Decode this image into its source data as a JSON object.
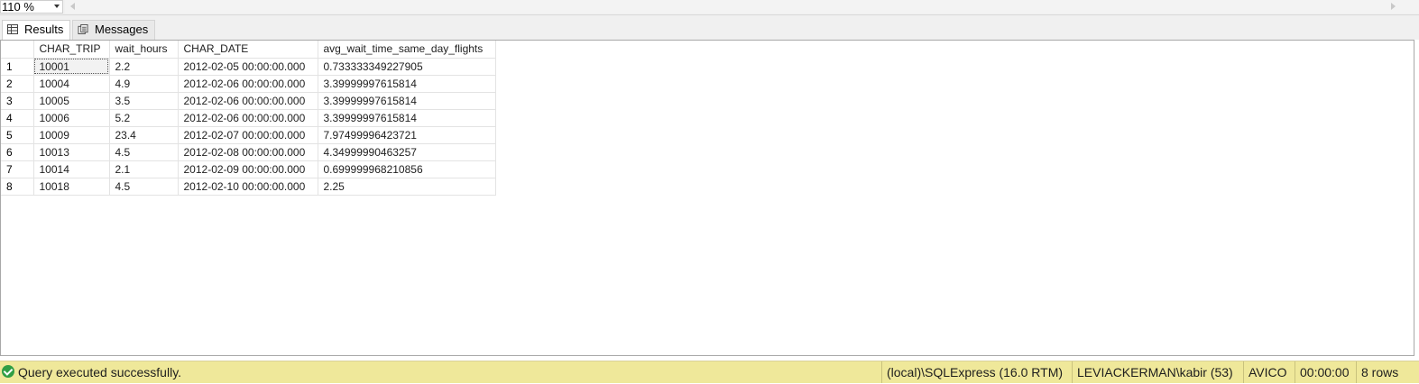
{
  "toolbar": {
    "zoom": "110 %"
  },
  "tabs": [
    {
      "label": "Results",
      "icon": "grid-icon"
    },
    {
      "label": "Messages",
      "icon": "messages-icon"
    }
  ],
  "grid": {
    "columns": [
      "CHAR_TRIP",
      "wait_hours",
      "CHAR_DATE",
      "avg_wait_time_same_day_flights"
    ],
    "rows": [
      {
        "n": "1",
        "cells": [
          "10001",
          "2.2",
          "2012-02-05 00:00:00.000",
          "0.733333349227905"
        ]
      },
      {
        "n": "2",
        "cells": [
          "10004",
          "4.9",
          "2012-02-06 00:00:00.000",
          "3.39999997615814"
        ]
      },
      {
        "n": "3",
        "cells": [
          "10005",
          "3.5",
          "2012-02-06 00:00:00.000",
          "3.39999997615814"
        ]
      },
      {
        "n": "4",
        "cells": [
          "10006",
          "5.2",
          "2012-02-06 00:00:00.000",
          "3.39999997615814"
        ]
      },
      {
        "n": "5",
        "cells": [
          "10009",
          "23.4",
          "2012-02-07 00:00:00.000",
          "7.97499996423721"
        ]
      },
      {
        "n": "6",
        "cells": [
          "10013",
          "4.5",
          "2012-02-08 00:00:00.000",
          "4.34999990463257"
        ]
      },
      {
        "n": "7",
        "cells": [
          "10014",
          "2.1",
          "2012-02-09 00:00:00.000",
          "0.699999968210856"
        ]
      },
      {
        "n": "8",
        "cells": [
          "10018",
          "4.5",
          "2012-02-10 00:00:00.000",
          "2.25"
        ]
      }
    ]
  },
  "status": {
    "message": "Query executed successfully.",
    "server": "(local)\\SQLExpress (16.0 RTM)",
    "user": "LEVIACKERMAN\\kabir (53)",
    "database": "AVICO",
    "elapsed": "00:00:00",
    "rows": "8 rows",
    "color": "#efe89a"
  }
}
